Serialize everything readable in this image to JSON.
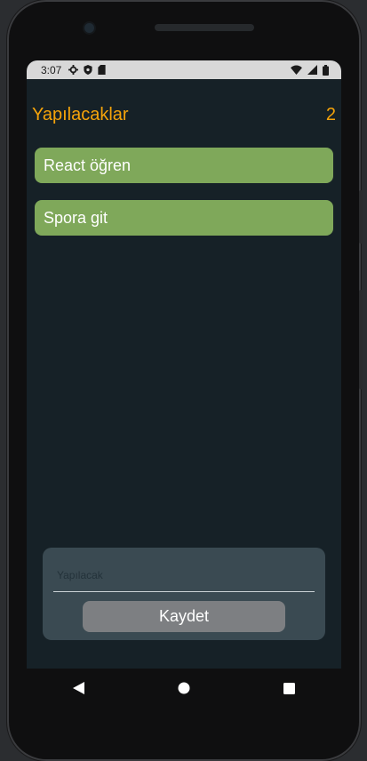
{
  "status_bar": {
    "time": "3:07",
    "icons": [
      "gear-icon",
      "shield-icon",
      "sd-card-icon"
    ],
    "right_icons": [
      "wifi-icon",
      "signal-icon",
      "battery-icon"
    ]
  },
  "app": {
    "title": "Yapılacaklar",
    "count": "2",
    "accent_color": "#f5a30a",
    "todo_color": "#7fa85a"
  },
  "todos": [
    {
      "label": "React öğren"
    },
    {
      "label": "Spora git"
    }
  ],
  "form": {
    "placeholder": "Yapılacak",
    "value": "",
    "save_label": "Kaydet"
  },
  "nav": [
    "back-icon",
    "home-icon",
    "recents-icon"
  ]
}
